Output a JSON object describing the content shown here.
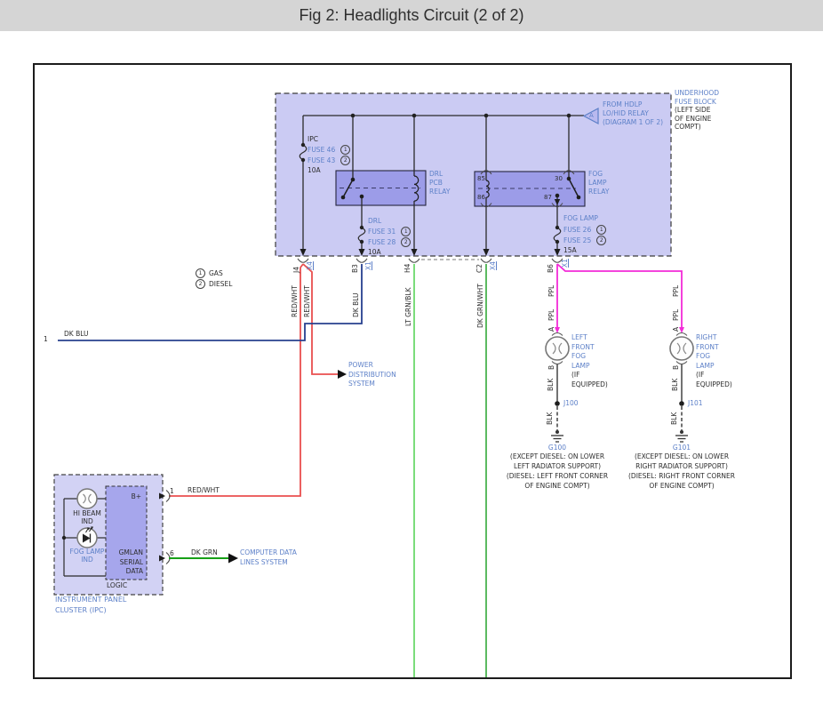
{
  "title": "Fig 2: Headlights Circuit (2 of 2)",
  "colors": {
    "titlebar_bg": "#d5d5d5",
    "label_blue": "#5d80c8",
    "fuse_block_fill": "#cbcbf3",
    "relay_fill": "#9c9ce8",
    "wire_red": "#e94f4f",
    "wire_dk_blu": "#27408f",
    "wire_lt_grn": "#6cd96c",
    "wire_dk_grn_wht": "#49b24f",
    "wire_ppl": "#f32bd8",
    "wire_blk": "#4f4f4f",
    "wire_dk_grn": "#17a017"
  },
  "legend": {
    "gas_num": "1",
    "gas": "GAS",
    "diesel_num": "2",
    "diesel": "DIESEL"
  },
  "fuse_block_label": {
    "l1": "UNDERHOOD",
    "l2": "FUSE BLOCK",
    "l3": "(LEFT SIDE",
    "l4": "OF ENGINE",
    "l5": "COMPT)"
  },
  "from_hdlp": {
    "marker": "A",
    "l1": "FROM HDLP",
    "l2": "LO/HID RELAY",
    "l3": "(DIAGRAM 1 OF 2)"
  },
  "ipc_fuse": {
    "name": "IPC",
    "fuse1": "FUSE 46",
    "fuse1_num": "1",
    "fuse2": "FUSE 43",
    "fuse2_num": "2",
    "amps": "10A"
  },
  "drl_relay": {
    "l1": "DRL",
    "l2": "PCB",
    "l3": "RELAY"
  },
  "fog_relay": {
    "l1": "FOG",
    "l2": "LAMP",
    "l3": "RELAY",
    "pin85": "85",
    "pin86": "86",
    "pin30": "30",
    "pin87": "87"
  },
  "drl_fuse": {
    "name": "DRL",
    "fuse1": "FUSE 31",
    "fuse1_num": "1",
    "fuse2": "FUSE 28",
    "fuse2_num": "2",
    "amps": "10A"
  },
  "fog_fuse": {
    "name": "FOG LAMP",
    "fuse1": "FUSE 26",
    "fuse1_num": "1",
    "fuse2": "FUSE 25",
    "fuse2_num": "2",
    "amps": "15A"
  },
  "pins": {
    "j4": "J4",
    "b3": "B3",
    "h4": "H4",
    "c2": "C2",
    "b6": "B6",
    "x4": "X4",
    "x1": "X1"
  },
  "wire_labels": {
    "red_wht": "RED/WHT",
    "dk_blu": "DK BLU",
    "lt_grn_blk": "LT GRN/BLK",
    "dk_grn_wht": "DK GRN/WHT",
    "ppl": "PPL",
    "blk": "BLK",
    "dk_grn": "DK GRN",
    "left_end_pin": "1"
  },
  "power_dist": {
    "l1": "POWER",
    "l2": "DISTRIBUTION",
    "l3": "SYSTEM"
  },
  "computer_data": {
    "l1": "COMPUTER DATA",
    "l2": "LINES SYSTEM"
  },
  "left_lamp": {
    "pin_a": "A",
    "pin_b": "B",
    "l1": "LEFT",
    "l2": "FRONT",
    "l3": "FOG",
    "l4": "LAMP",
    "l5": "(IF",
    "l6": "EQUIPPED)",
    "splice": "J100",
    "ground": "G100",
    "g1": "(EXCEPT DIESEL: ON LOWER",
    "g2": "LEFT RADIATOR SUPPORT)",
    "g3": "(DIESEL: LEFT FRONT CORNER",
    "g4": "OF ENGINE COMPT)"
  },
  "right_lamp": {
    "pin_a": "A",
    "pin_b": "B",
    "l1": "RIGHT",
    "l2": "FRONT",
    "l3": "FOG",
    "l4": "LAMP",
    "l5": "(IF",
    "l6": "EQUIPPED)",
    "splice": "J101",
    "ground": "G101",
    "g1": "(EXCEPT DIESEL: ON LOWER",
    "g2": "RIGHT RADIATOR SUPPORT)",
    "g3": "(DIESEL: RIGHT FRONT CORNER",
    "g4": "OF ENGINE COMPT)"
  },
  "ipc": {
    "label1": "INSTRUMENT PANEL",
    "label2": "CLUSTER (IPC)",
    "logic": "LOGIC",
    "bplus": "B+",
    "gmlan1": "GMLAN",
    "gmlan2": "SERIAL",
    "gmlan3": "DATA",
    "hibeam1": "HI BEAM",
    "hibeam2": "IND",
    "foglamp1": "FOG LAMP",
    "foglamp2": "IND",
    "pin1": "1",
    "pin6": "6"
  }
}
